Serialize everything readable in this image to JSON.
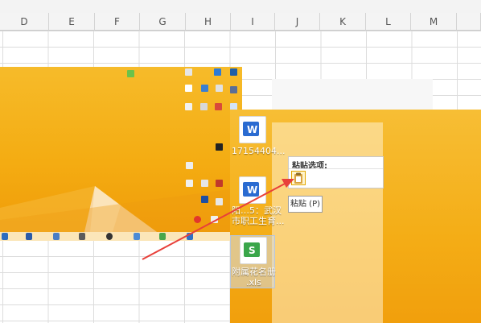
{
  "columns": [
    "D",
    "E",
    "F",
    "G",
    "H",
    "I",
    "J",
    "K",
    "L",
    "M"
  ],
  "desktop_files": [
    {
      "icon": "word-doc-icon",
      "label": "17154404..."
    },
    {
      "icon": "word-doc-icon",
      "label_lines": [
        "阳…5：武汉",
        "市职工生育..."
      ]
    },
    {
      "icon": "spreadsheet-icon",
      "label_lines": [
        "附属花名册",
        ".xls"
      ]
    }
  ],
  "paste_menu": {
    "title": "粘贴选项:",
    "tooltip": "粘贴 (P)"
  },
  "colors": {
    "accent_arrow": "#e8403a",
    "desktop_bg": "#f4ac12"
  }
}
